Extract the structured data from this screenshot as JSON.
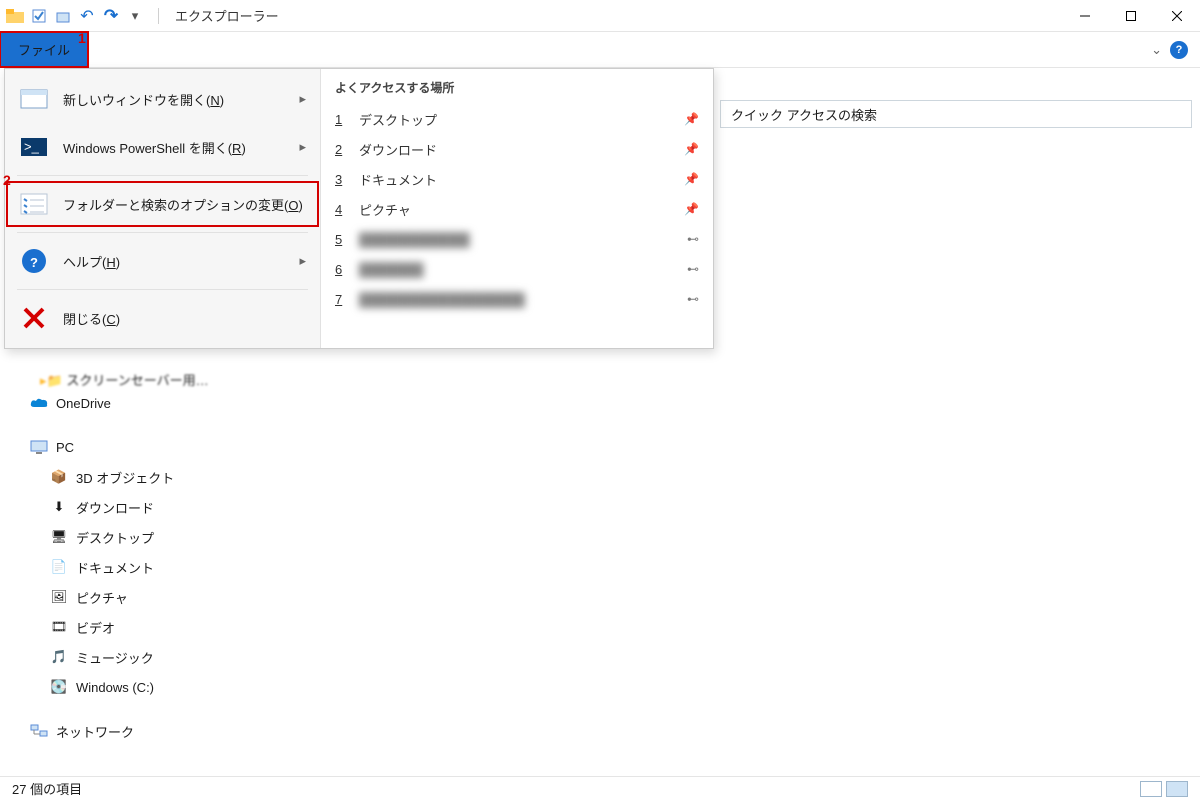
{
  "window": {
    "title": "エクスプローラー"
  },
  "ribbon": {
    "file_tab": "ファイル"
  },
  "callouts": {
    "one": "1",
    "two": "2"
  },
  "file_menu": {
    "items": {
      "new_window": {
        "label": "新しいウィンドウを開く(",
        "ak": "N",
        "tail": ")"
      },
      "powershell": {
        "label": "Windows PowerShell を開く(",
        "ak": "R",
        "tail": ")"
      },
      "options": {
        "label": "フォルダーと検索のオプションの変更(",
        "ak": "O",
        "tail": ")"
      },
      "help": {
        "label": "ヘルプ(",
        "ak": "H",
        "tail": ")"
      },
      "close": {
        "label": "閉じる(",
        "ak": "C",
        "tail": ")"
      }
    },
    "frequent_header": "よくアクセスする場所",
    "frequent": [
      {
        "n": "1",
        "label": "デスクトップ",
        "pinned": true
      },
      {
        "n": "2",
        "label": "ダウンロード",
        "pinned": true
      },
      {
        "n": "3",
        "label": "ドキュメント",
        "pinned": true
      },
      {
        "n": "4",
        "label": "ピクチャ",
        "pinned": true
      },
      {
        "n": "5",
        "label": "████████████",
        "pinned": false,
        "blur": true
      },
      {
        "n": "6",
        "label": "███████",
        "pinned": false,
        "blur": true
      },
      {
        "n": "7",
        "label": "██████████████████",
        "pinned": false,
        "blur": true
      }
    ]
  },
  "search": {
    "placeholder": "クイック アクセスの検索"
  },
  "tree": {
    "peek": "スクリーンセーバー用…",
    "onedrive": "OneDrive",
    "pc": "PC",
    "pc_children": [
      "3D オブジェクト",
      "ダウンロード",
      "デスクトップ",
      "ドキュメント",
      "ピクチャ",
      "ビデオ",
      "ミュージック",
      "Windows (C:)"
    ],
    "network": "ネットワーク"
  },
  "status": {
    "items": "27 個の項目"
  },
  "icons": {
    "folder": "folder-icon",
    "undo": "undo-icon",
    "redo": "redo-icon"
  }
}
